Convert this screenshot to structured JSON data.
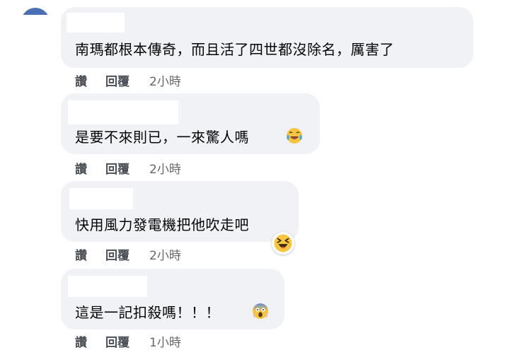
{
  "comments": [
    {
      "text": "南瑪都根本傳奇，而且活了四世都沒除名，厲害了",
      "actions": {
        "like": "讚",
        "reply": "回覆",
        "time": "2小時"
      }
    },
    {
      "text": "是要不來則已，一來驚人嗎",
      "emoji": "tears-of-joy-emoji",
      "actions": {
        "like": "讚",
        "reply": "回覆",
        "time": "2小時"
      }
    },
    {
      "text": "快用風力發電機把他吹走吧",
      "reaction": "haha-reaction-icon",
      "actions": {
        "like": "讚",
        "reply": "回覆",
        "time": "2小時"
      }
    },
    {
      "text": "這是一記扣殺嗎！！！",
      "emoji": "screaming-in-fear-emoji",
      "actions": {
        "like": "讚",
        "reply": "回覆",
        "time": "1小時"
      }
    }
  ],
  "colors": {
    "bubble": "#f0f2f5",
    "text": "#050505",
    "meta": "#65676b",
    "avatar": "#4a6fb5"
  }
}
